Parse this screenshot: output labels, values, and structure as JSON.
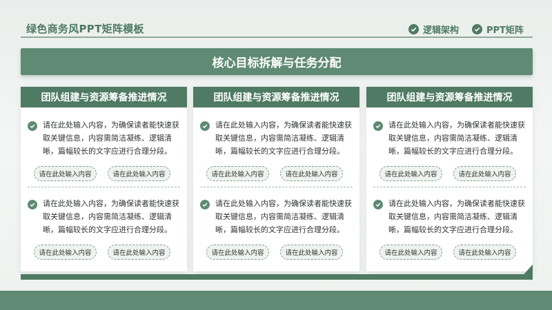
{
  "header": {
    "title": "绿色商务风PPT矩阵模板",
    "nav": [
      {
        "label": "逻辑架构",
        "icon": "check-circle-icon"
      },
      {
        "label": "PPT矩阵",
        "icon": "check-circle-icon"
      }
    ]
  },
  "banner": {
    "title": "核心目标拆解与任务分配"
  },
  "cards": [
    {
      "title": "团队组建与资源筹备推进情况",
      "sections": [
        {
          "text": "请在此处输入内容，为确保读者能快速获取关键信息，内容需简洁凝练、逻辑清晰，篇幅较长的文字应进行合理分段。",
          "tags": [
            "请在此处输入内容",
            "请在此处输入内容"
          ]
        },
        {
          "text": "请在此处输入内容，为确保读者能快速获取关键信息，内容需简洁凝练、逻辑清晰，篇幅较长的文字应进行合理分段。",
          "tags": [
            "请在此处输入内容",
            "请在此处输入内容"
          ]
        }
      ]
    },
    {
      "title": "团队组建与资源筹备推进情况",
      "sections": [
        {
          "text": "请在此处输入内容，为确保读者能快速获取关键信息，内容需简洁凝练、逻辑清晰，篇幅较长的文字应进行合理分段。",
          "tags": [
            "请在此处输入内容",
            "请在此处输入内容"
          ]
        },
        {
          "text": "请在此处输入内容，为确保读者能快速获取关键信息，内容需简洁凝练、逻辑清晰，篇幅较长的文字应进行合理分段。",
          "tags": [
            "请在此处输入内容",
            "请在此处输入内容"
          ]
        }
      ]
    },
    {
      "title": "团队组建与资源筹备推进情况",
      "sections": [
        {
          "text": "请在此处输入内容，为确保读者能快速获取关键信息，内容需简洁凝练、逻辑清晰，篇幅较长的文字应进行合理分段。",
          "tags": [
            "请在此处输入内容",
            "请在此处输入内容"
          ]
        },
        {
          "text": "请在此处输入内容，为确保读者能快速获取关键信息，内容需简洁凝练、逻辑清晰，篇幅较长的文字应进行合理分段。",
          "tags": [
            "请在此处输入内容",
            "请在此处输入内容"
          ]
        }
      ]
    }
  ],
  "colors": {
    "primary": "#4f7a63",
    "banner": "#5f8a73",
    "tag_bg": "#eef3f0"
  }
}
